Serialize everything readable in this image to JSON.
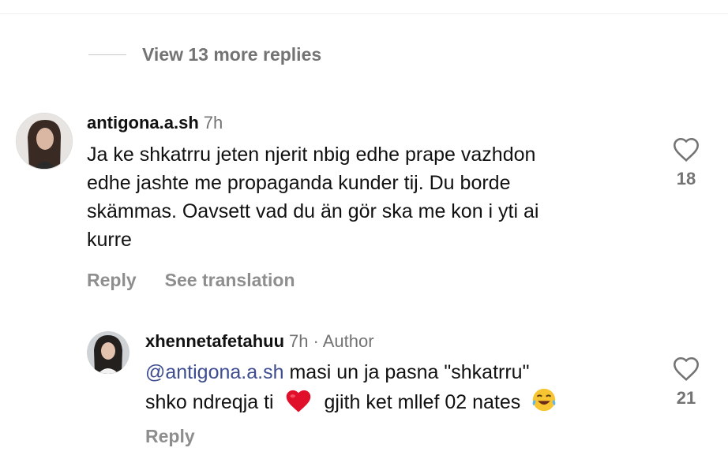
{
  "thread": {
    "view_more_label": "View 13 more replies"
  },
  "comments": [
    {
      "username": "antigona.a.sh",
      "time": "7h",
      "lines": [
        "Ja ke shkatrru jeten njerit nbig edhe prape vazhdon",
        "edhe jashte me propaganda kunder tij. Du borde",
        "skämmas. Oavsett vad du än gör ska me kon i yti ai",
        "kurre"
      ],
      "likes": "18",
      "reply_label": "Reply",
      "translate_label": "See translation"
    },
    {
      "username": "xhennetafetahuu",
      "time": "7h",
      "badge": "· Author",
      "mention": "@antigona.a.sh",
      "line1_rest": " masi un ja pasna \"shkatrru\"",
      "line2_a": "shko ndreqja ti",
      "line2_b": "gjith ket mllef 02 nates",
      "emojis": [
        "red-heart-emoji",
        "tears-of-joy-emoji"
      ],
      "likes": "21",
      "reply_label": "Reply"
    }
  ],
  "colors": {
    "text": "#111111",
    "secondary": "#737373",
    "mention": "#3e4d8f",
    "heart_emoji": "#e0102b"
  },
  "icons": {
    "like": "heart-outline-icon"
  }
}
